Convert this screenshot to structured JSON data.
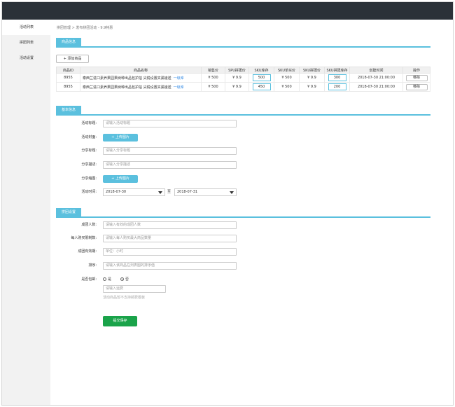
{
  "sidebar": {
    "items": [
      {
        "label": "活动列表"
      },
      {
        "label": "拼团列表"
      },
      {
        "label": "活动设置"
      }
    ]
  },
  "breadcrumb": "拼团管理 > 发布拼团活动 - 9.9特惠",
  "sections": {
    "goods": "商品信息",
    "basic": "基本信息",
    "group": "拼团设置"
  },
  "goods": {
    "add_label": "+ 添加商品",
    "columns": [
      "商品ID",
      "商品名称",
      "销售价",
      "SPU拼团价",
      "SKU库存",
      "SKU单买价",
      "SKU拼团价",
      "SKU拼团库存",
      "创建时间",
      "操作"
    ],
    "rows": [
      {
        "id": "8955",
        "name": "泰西兰进口素养果园果树种出品包护拍 尖锐设置实漏速送",
        "link": "一级库",
        "price": "¥ 500",
        "spu_price": "¥ 9.9",
        "stock": "500",
        "sku_single": "¥ 500",
        "sku_group": "¥ 9.9",
        "group_stock": "300",
        "created": "2018-07-30 21:00:00",
        "action": "移除"
      },
      {
        "id": "8955",
        "name": "泰西兰进口素养果园果树种出品包护拍 尖锐设置实漏速送",
        "link": "一级库",
        "price": "¥ 500",
        "spu_price": "¥ 9.9",
        "stock": "450",
        "sku_single": "¥ 500",
        "sku_group": "¥ 9.9",
        "group_stock": "200",
        "created": "2018-07-30 21:00:00",
        "action": "移除"
      }
    ]
  },
  "basic": {
    "title_label": "活动标题:",
    "title_placeholder": "请输入活动标题",
    "cover_label": "活动封面:",
    "upload_label": "+ 上传图片",
    "share_title_label": "分享标题:",
    "share_title_placeholder": "请输入分享标题",
    "share_desc_label": "分享描述:",
    "share_desc_placeholder": "请输入分享描述",
    "share_img_label": "分享缩图:",
    "time_label": "活动时间:",
    "start_date": "2018-07-30",
    "to_label": "至",
    "end_date": "2018-07-31"
  },
  "group": {
    "size_label": "成团人数:",
    "size_placeholder": "请输入有效的成团人数",
    "limit_label": "每人购买限制数:",
    "limit_placeholder": "请输入每人购买最大商品数量",
    "valid_label": "成团有效期:",
    "valid_placeholder": "单位：小时",
    "sort_label": "排序:",
    "sort_placeholder": "请输入该商品在列表图的排序值",
    "ship_label": "是否包邮:",
    "ship_yes": "是",
    "ship_no": "否",
    "fee_placeholder": "请输入运费",
    "fee_hint": "活动商品暂不支持邮费模板"
  },
  "submit_label": "提交保存"
}
